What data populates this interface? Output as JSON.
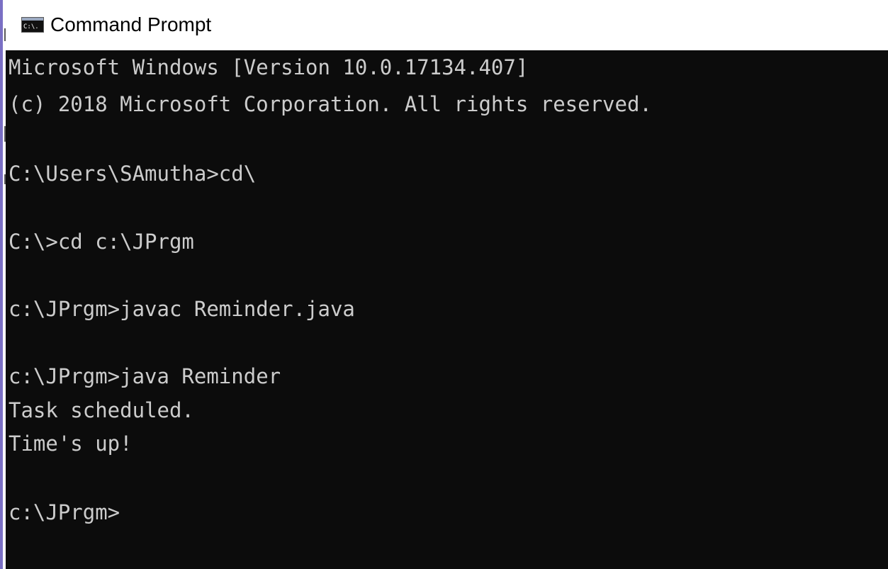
{
  "window": {
    "title": "Command Prompt",
    "icon": "command-prompt-icon",
    "icon_text": "C:\\."
  },
  "console": {
    "background": "#0c0c0c",
    "foreground": "#cccccc",
    "lines": [
      "Microsoft Windows [Version 10.0.17134.407]",
      "(c) 2018 Microsoft Corporation. All rights reserved.",
      "C:\\Users\\SAmutha>cd\\",
      "C:\\>cd c:\\JPrgm",
      "c:\\JPrgm>javac Reminder.java",
      "c:\\JPrgm>java Reminder",
      "Task scheduled.",
      "Time's up!",
      "c:\\JPrgm>"
    ]
  }
}
